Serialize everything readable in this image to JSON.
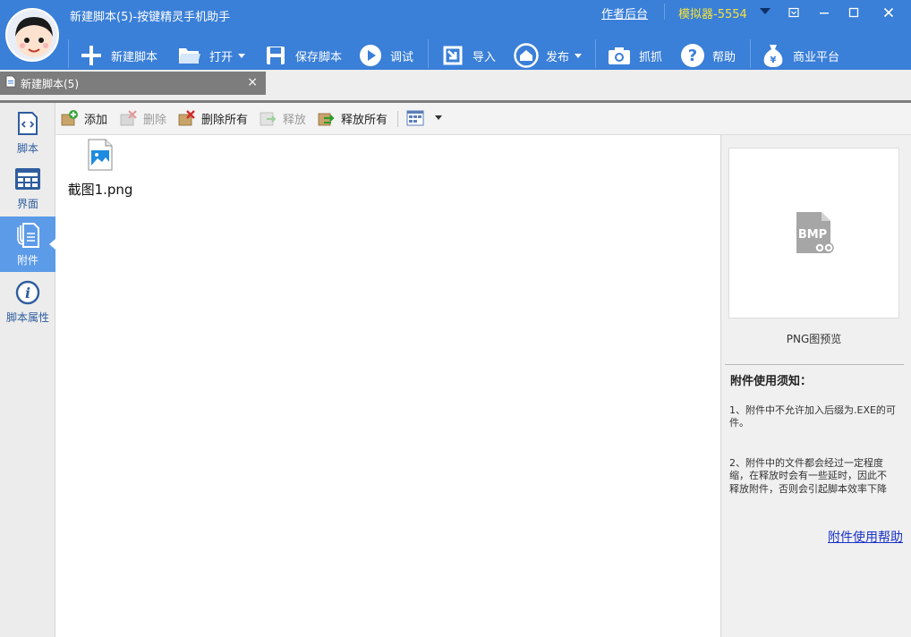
{
  "window": {
    "title": "新建脚本(5)-按键精灵手机助手",
    "author_link": "作者后台",
    "emulator": "模拟器-5554"
  },
  "toolbar": {
    "items": [
      {
        "label": "新建脚本",
        "icon": "plus-icon"
      },
      {
        "label": "打开",
        "icon": "folder-icon"
      },
      {
        "label": "保存脚本",
        "icon": "save-icon"
      },
      {
        "label": "调试",
        "icon": "play-icon"
      },
      {
        "label": "导入",
        "icon": "import-icon"
      },
      {
        "label": "发布",
        "icon": "publish-icon"
      },
      {
        "label": "抓抓",
        "icon": "camera-icon"
      },
      {
        "label": "帮助",
        "icon": "help-icon"
      },
      {
        "label": "商业平台",
        "icon": "money-bag-icon"
      }
    ]
  },
  "tab": {
    "label": "新建脚本(5)",
    "close": "×"
  },
  "sidebar": {
    "items": [
      {
        "label": "脚本",
        "icon": "script-icon"
      },
      {
        "label": "界面",
        "icon": "interface-icon"
      },
      {
        "label": "附件",
        "icon": "attachment-icon",
        "active": true
      },
      {
        "label": "脚本属性",
        "icon": "info-icon"
      }
    ]
  },
  "attachment_toolbar": {
    "add": "添加",
    "delete": "删除",
    "delete_all": "删除所有",
    "release": "释放",
    "release_all": "释放所有"
  },
  "files": [
    {
      "name": "截图1.png",
      "icon": "image-file-icon"
    }
  ],
  "preview": {
    "caption": "PNG图预览",
    "placeholder_text": "BMP"
  },
  "notice": {
    "title": "附件使用须知：",
    "line1a": "1、附件中不允许加入后缀为.EXE的可",
    "line1b": "件。",
    "line2a": "2、附件中的文件都会经过一定程度",
    "line2b": "缩，在释放时会有一些延时，因此不",
    "line2c": "释放附件，否则会引起脚本效率下降",
    "help_link": "附件使用帮助"
  },
  "colors": {
    "titlebar": "#3a7fd8",
    "sidebar_active": "#5c9be8",
    "emulator_text": "#f6e23a",
    "link": "#1a33c9"
  }
}
